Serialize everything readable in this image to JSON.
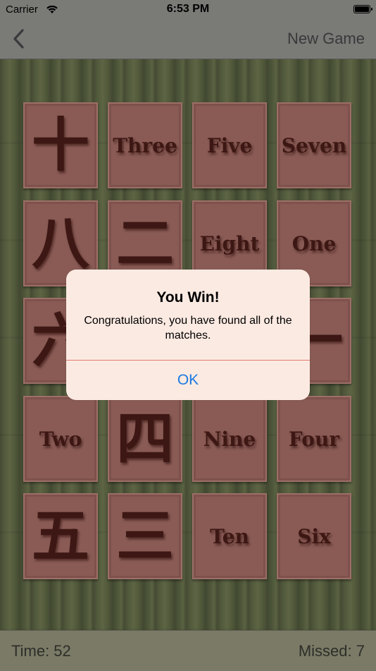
{
  "status_bar": {
    "carrier": "Carrier",
    "time": "6:53 PM"
  },
  "nav": {
    "new_game": "New Game"
  },
  "tiles": [
    {
      "text": "十",
      "kind": "kanji"
    },
    {
      "text": "Three",
      "kind": "word"
    },
    {
      "text": "Five",
      "kind": "word"
    },
    {
      "text": "Seven",
      "kind": "word"
    },
    {
      "text": "八",
      "kind": "kanji"
    },
    {
      "text": "二",
      "kind": "kanji"
    },
    {
      "text": "Eight",
      "kind": "word"
    },
    {
      "text": "One",
      "kind": "word"
    },
    {
      "text": "六",
      "kind": "kanji"
    },
    {
      "text": "",
      "kind": "kanji"
    },
    {
      "text": "",
      "kind": "word"
    },
    {
      "text": "一",
      "kind": "kanji"
    },
    {
      "text": "Two",
      "kind": "word"
    },
    {
      "text": "四",
      "kind": "kanji"
    },
    {
      "text": "Nine",
      "kind": "word"
    },
    {
      "text": "Four",
      "kind": "word"
    },
    {
      "text": "五",
      "kind": "kanji"
    },
    {
      "text": "三",
      "kind": "kanji"
    },
    {
      "text": "Ten",
      "kind": "word"
    },
    {
      "text": "Six",
      "kind": "word"
    }
  ],
  "alert": {
    "title": "You Win!",
    "message": "Congratulations, you have found all of the matches.",
    "ok": "OK"
  },
  "footer": {
    "time": "Time: 52",
    "missed": "Missed: 7"
  }
}
